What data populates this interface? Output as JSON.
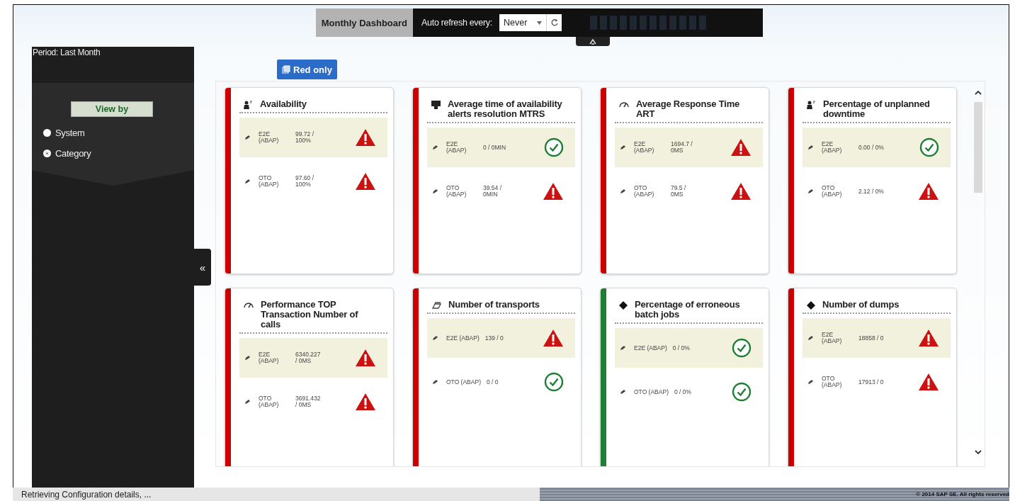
{
  "toolbar": {
    "title": "Monthly Dashboard",
    "refresh_label": "Auto refresh every:",
    "refresh_value": "Never"
  },
  "sidebar": {
    "period": "Period: Last Month",
    "view_by": "View by",
    "options": [
      {
        "label": "System",
        "selected": false
      },
      {
        "label": "Category",
        "selected": true
      }
    ],
    "collapse": "«"
  },
  "filter_button": "Red only",
  "cards": [
    {
      "title": "Availability",
      "kind": "person",
      "color": "#cc0000",
      "inline_rows": false,
      "rows": [
        {
          "system": "E2E (ABAP)",
          "value": "99.72 / 100%",
          "kind": "alert",
          "selected": true
        },
        {
          "system": "OTO (ABAP)",
          "value": "97.60 / 100%",
          "kind": "alert",
          "selected": false
        }
      ]
    },
    {
      "title": "Average time of availability alerts resolution MTRS",
      "kind": "monitor",
      "color": "#cc0000",
      "inline_rows": false,
      "rows": [
        {
          "system": "E2E (ABAP)",
          "value": "0 / 0MIN",
          "kind": "ok",
          "selected": true
        },
        {
          "system": "OTO (ABAP)",
          "value": "39.54 / 0MIN",
          "kind": "alert",
          "selected": false
        }
      ]
    },
    {
      "title": "Average Response Time ART",
      "kind": "gauge",
      "color": "#cc0000",
      "inline_rows": false,
      "rows": [
        {
          "system": "E2E (ABAP)",
          "value": "1694.7 / 0MS",
          "kind": "alert",
          "selected": true
        },
        {
          "system": "OTO (ABAP)",
          "value": "79.5 / 0MS",
          "kind": "alert",
          "selected": false
        }
      ]
    },
    {
      "title": "Percentage of unplanned downtime",
      "kind": "person",
      "color": "#cc0000",
      "inline_rows": false,
      "rows": [
        {
          "system": "E2E (ABAP)",
          "value": "0.00 / 0%",
          "kind": "ok",
          "selected": true
        },
        {
          "system": "OTO (ABAP)",
          "value": "2.12 / 0%",
          "kind": "alert",
          "selected": false
        }
      ]
    },
    {
      "title": "Performance TOP Transaction Number of calls",
      "kind": "gauge",
      "color": "#cc0000",
      "inline_rows": false,
      "rows": [
        {
          "system": "E2E (ABAP)",
          "value": "6340.227 / 0MS",
          "kind": "alert",
          "selected": true
        },
        {
          "system": "OTO (ABAP)",
          "value": "3691.432 / 0MS",
          "kind": "alert",
          "selected": false
        }
      ]
    },
    {
      "title": "Number of transports",
      "kind": "transport",
      "color": "#cc0000",
      "inline_rows": true,
      "rows": [
        {
          "system": "E2E (ABAP)",
          "value": "139 / 0",
          "kind": "alert",
          "selected": true
        },
        {
          "system": "OTO (ABAP)",
          "value": "0 / 0",
          "kind": "ok",
          "selected": false
        }
      ]
    },
    {
      "title": "Percentage of erroneous batch jobs",
      "kind": "diamond",
      "color": "#1e7e34",
      "inline_rows": true,
      "rows": [
        {
          "system": "E2E (ABAP)",
          "value": "0 / 0%",
          "kind": "ok",
          "selected": true
        },
        {
          "system": "OTO (ABAP)",
          "value": "0 / 0%",
          "kind": "ok",
          "selected": false
        }
      ]
    },
    {
      "title": "Number of dumps",
      "kind": "diamond",
      "color": "#cc0000",
      "inline_rows": false,
      "rows": [
        {
          "system": "E2E (ABAP)",
          "value": "18858 / 0",
          "kind": "alert",
          "selected": true
        },
        {
          "system": "OTO (ABAP)",
          "value": "17913 / 0",
          "kind": "alert",
          "selected": false
        }
      ]
    }
  ],
  "status_bar": {
    "message": "Retrieving Configuration details, ...",
    "copyright": "© 2014 SAP SE. All rights reserved"
  }
}
